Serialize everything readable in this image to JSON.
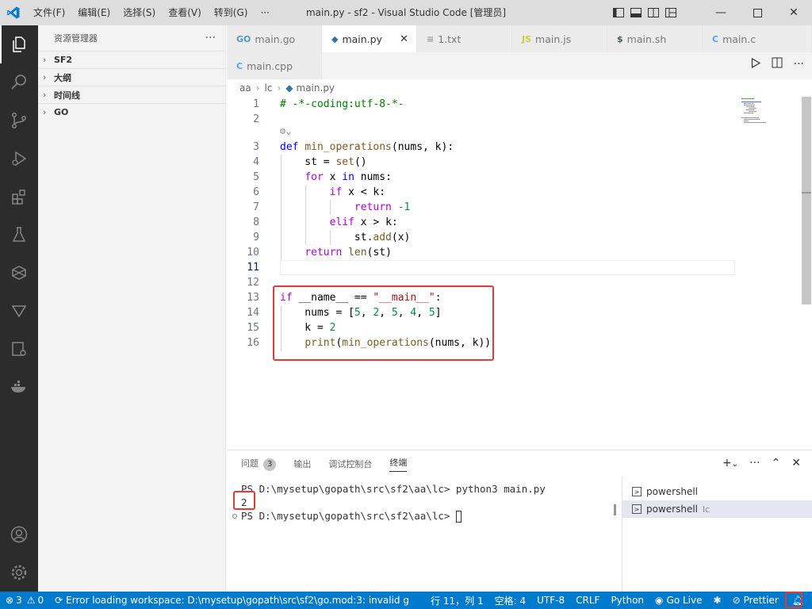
{
  "titlebar": {
    "menu": [
      "文件(F)",
      "编辑(E)",
      "选择(S)",
      "查看(V)",
      "转到(G)",
      "···"
    ],
    "window_title": "main.py - sf2 - Visual Studio Code [管理员]"
  },
  "sidebar": {
    "title": "资源管理器",
    "more": "···",
    "sections": [
      "SF2",
      "大纲",
      "时间线",
      "GO"
    ]
  },
  "tabs": [
    {
      "icon": "GO",
      "label": "main.go",
      "icon_color": "#519aba"
    },
    {
      "icon": "py",
      "label": "main.py",
      "icon_color": "#3572a5",
      "active": true
    },
    {
      "icon": "≡",
      "label": "1.txt",
      "icon_color": "#999999"
    },
    {
      "icon": "JS",
      "label": "main.js",
      "icon_color": "#cbcb41"
    },
    {
      "icon": "$",
      "label": "main.sh",
      "icon_color": "#4d5a5e"
    },
    {
      "icon": "C",
      "label": "main.c",
      "icon_color": "#599eff"
    },
    {
      "icon": "C",
      "label": "main.cpp",
      "icon_color": "#599eff"
    }
  ],
  "breadcrumb": [
    "aa",
    "lc",
    "main.py"
  ],
  "editor": {
    "line_numbers": [
      "1",
      "2",
      "3",
      "4",
      "5",
      "6",
      "7",
      "8",
      "9",
      "10",
      "11",
      "12",
      "13",
      "14",
      "15",
      "16"
    ],
    "lines": [
      "# -*-coding:utf-8-*-",
      "",
      "def min_operations(nums, k):",
      "    st = set()",
      "    for x in nums:",
      "        if x < k:",
      "            return -1",
      "        elif x > k:",
      "            st.add(x)",
      "    return len(st)",
      "",
      "",
      "if __name__ == \"__main__\":",
      "    nums = [5, 2, 5, 4, 5]",
      "    k = 2",
      "    print(min_operations(nums, k))"
    ]
  },
  "panel": {
    "tabs": [
      "问题",
      "输出",
      "调试控制台",
      "终端"
    ],
    "problems_count": "3",
    "terminal_lines": [
      "PS D:\\mysetup\\gopath\\src\\sf2\\aa\\lc> python3 main.py",
      "2",
      "PS D:\\mysetup\\gopath\\src\\sf2\\aa\\lc> "
    ],
    "terminals": [
      {
        "label": "powershell",
        "sub": ""
      },
      {
        "label": "powershell",
        "sub": "lc"
      }
    ]
  },
  "statusbar": {
    "errors": "3",
    "warnings": "0",
    "message": "Error loading workspace: D:\\mysetup\\gopath\\src\\sf2\\go.mod:3: invalid g",
    "position": "行 11，列 1",
    "spaces": "空格: 4",
    "encoding": "UTF-8",
    "eol": "CRLF",
    "language": "Python",
    "golive": "Go Live",
    "prettier": "Prettier"
  },
  "colors": {
    "accent": "#007acc",
    "highlight": "#e53935"
  }
}
